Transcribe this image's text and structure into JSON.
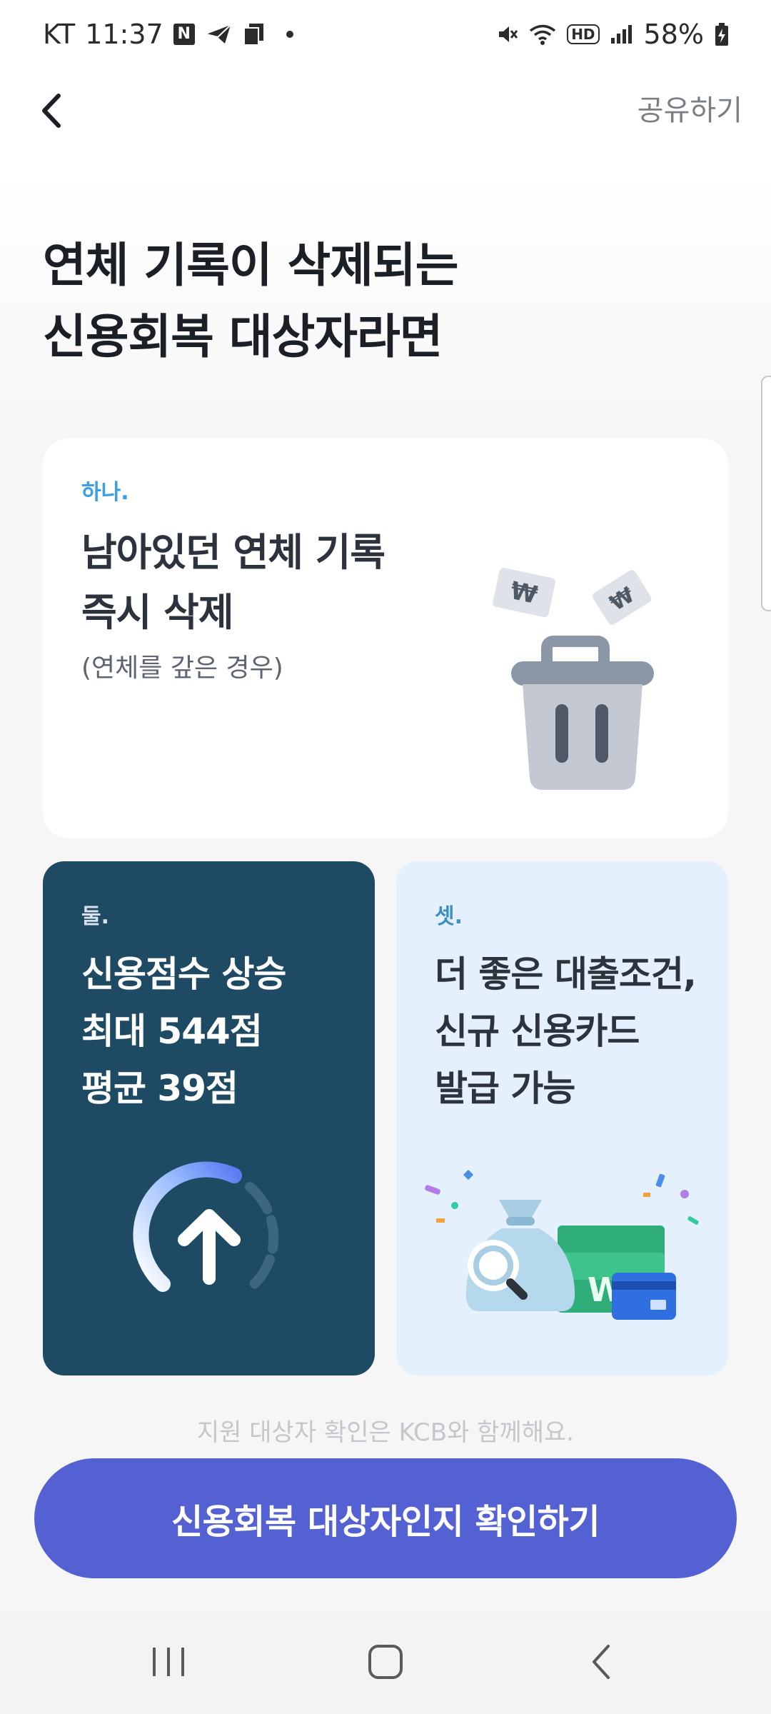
{
  "status_bar": {
    "carrier": "KT",
    "time": "11:37",
    "notification_badge": "N",
    "hd_label": "HD",
    "battery": "58%"
  },
  "header": {
    "share_label": "공유하기"
  },
  "title": {
    "line1": "연체 기록이 삭제되는",
    "line2": "신용회복 대상자라면"
  },
  "cards": [
    {
      "number": "하나.",
      "lines": [
        "남아있던 연체 기록",
        "즉시 삭제"
      ],
      "note": "(연체를 갚은 경우)",
      "illustration": "trash-bin-with-bills-icon"
    },
    {
      "number": "둘.",
      "lines": [
        "신용점수 상승",
        "최대 544점",
        "평균 39점"
      ],
      "illustration": "score-up-arrow-icon"
    },
    {
      "number": "셋.",
      "lines": [
        "더 좋은 대출조건,",
        "신규 신용카드",
        "발급 가능"
      ],
      "illustration": "money-bag-card-icon"
    }
  ],
  "notice": "지원 대상자 확인은 KCB와 함께해요.",
  "cta_label": "신용회복 대상자인지 확인하기",
  "nav": {
    "recent_icon": "recent-apps-icon",
    "home_icon": "home-icon",
    "back_icon": "nav-back-icon"
  },
  "colors": {
    "primary": "#5461d2",
    "card_dark": "#1e4a63",
    "card_light": "#e4f1fc",
    "accent_blue": "#3aa0e6"
  }
}
